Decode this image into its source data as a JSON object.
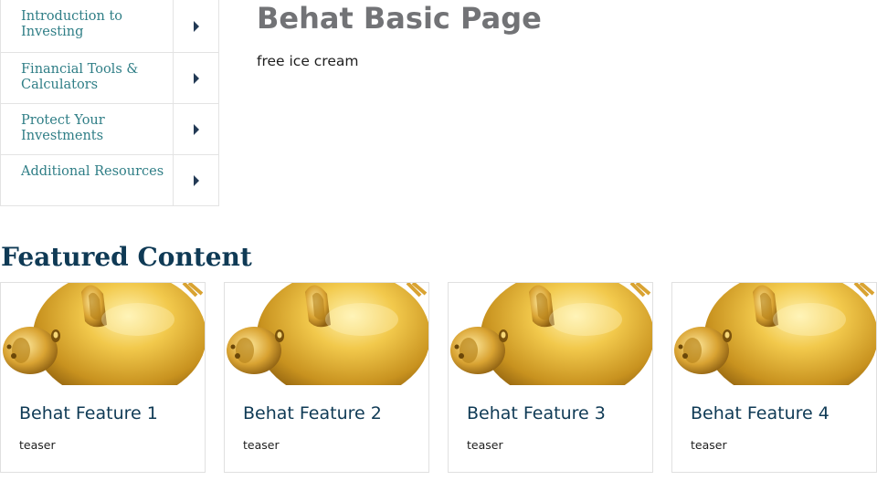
{
  "sidebar": {
    "items": [
      {
        "label": "Introduction to Investing"
      },
      {
        "label": "Financial Tools & Calculators"
      },
      {
        "label": "Protect Your Investments"
      },
      {
        "label": "Additional Resources"
      }
    ]
  },
  "main": {
    "title": "Behat Basic Page",
    "body": "free ice cream"
  },
  "featured": {
    "heading": "Featured Content",
    "cards": [
      {
        "title": "Behat Feature 1",
        "teaser": "teaser",
        "image": "gold-piggy-bank"
      },
      {
        "title": "Behat Feature 2",
        "teaser": "teaser",
        "image": "gold-piggy-bank"
      },
      {
        "title": "Behat Feature 3",
        "teaser": "teaser",
        "image": "gold-piggy-bank"
      },
      {
        "title": "Behat Feature 4",
        "teaser": "teaser",
        "image": "gold-piggy-bank"
      }
    ]
  },
  "colors": {
    "link": "#2f7e86",
    "heading_dark": "#0f3a55",
    "title_gray": "#727376",
    "caret": "#233a55",
    "gold": "#e2b33c"
  }
}
